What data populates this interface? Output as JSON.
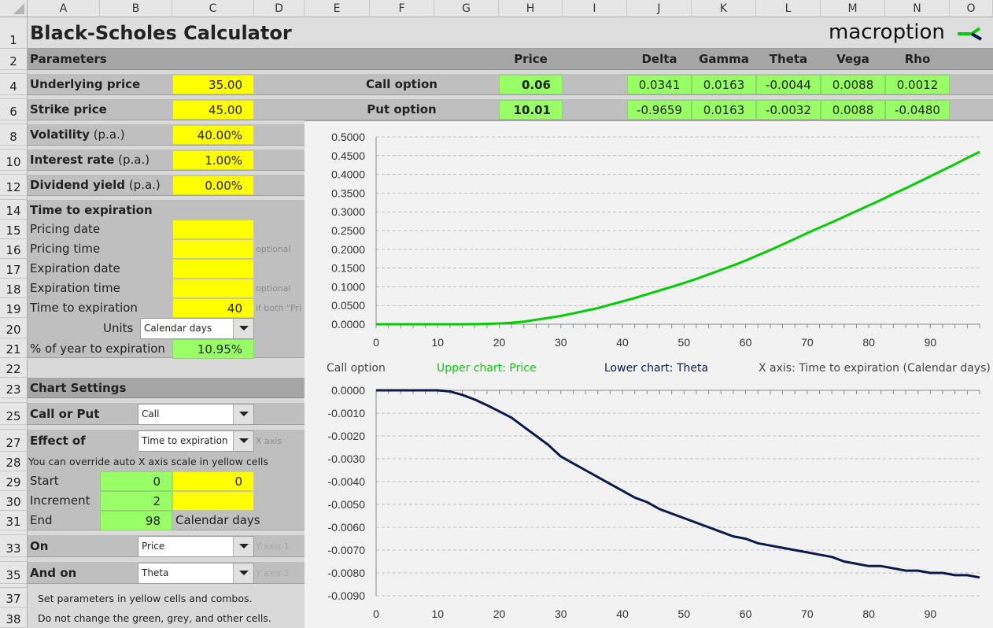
{
  "columns": [
    "A",
    "B",
    "C",
    "D",
    "E",
    "F",
    "G",
    "H",
    "I",
    "J",
    "K",
    "L",
    "M",
    "N",
    "O"
  ],
  "rows": [
    "1",
    "2",
    "4",
    "6",
    "8",
    "10",
    "12",
    "14",
    "15",
    "16",
    "17",
    "18",
    "19",
    "20",
    "21",
    "22",
    "23",
    "25",
    "27",
    "28",
    "29",
    "30",
    "31",
    "33",
    "35",
    "37",
    "38"
  ],
  "title": "Black-Scholes Calculator",
  "logo": {
    "text": "macroption",
    "colors": [
      "#00cc00",
      "#0b1a4a"
    ]
  },
  "parameters": {
    "header": "Parameters",
    "underlying_label": "Underlying price",
    "underlying": "35.00",
    "strike_label": "Strike price",
    "strike": "45.00",
    "volatility_label": "Volatility",
    "volatility_suffix": "(p.a.)",
    "volatility": "40.00%",
    "interest_label": "Interest rate",
    "interest_suffix": "(p.a.)",
    "interest": "1.00%",
    "dividend_label": "Dividend yield",
    "dividend_suffix": "(p.a.)",
    "dividend": "0.00%"
  },
  "time": {
    "header": "Time to expiration",
    "pricing_date_label": "Pricing date",
    "pricing_date": "",
    "pricing_time_label": "Pricing time",
    "pricing_time": "",
    "pricing_time_note": "optional",
    "expiration_date_label": "Expiration date",
    "expiration_date": "",
    "expiration_time_label": "Expiration time",
    "expiration_time": "",
    "expiration_time_note": "optional",
    "tte_label": "Time to expiration",
    "tte": "40",
    "tte_note": "if both \"Pri",
    "units_label": "Units",
    "units": "Calendar days",
    "pct_label": "% of year to expiration",
    "pct": "10.95%"
  },
  "chart_settings": {
    "header": "Chart Settings",
    "call_put_label": "Call or Put",
    "call_put": "Call",
    "effect_label": "Effect of",
    "effect": "Time to expiration",
    "effect_note": "X axis",
    "override_note": "You can override auto X axis scale in yellow cells",
    "start_label": "Start",
    "start_auto": "0",
    "start_override": "0",
    "increment_label": "Increment",
    "increment_auto": "2",
    "increment_override": "",
    "end_label": "End",
    "end_auto": "98",
    "end_unit": "Calendar days",
    "on_label": "On",
    "on": "Price",
    "on_note": "Y axis 1",
    "and_on_label": "And on",
    "and_on": "Theta",
    "and_on_note": "Y axis 2",
    "help1": "Set parameters in yellow cells and combos.",
    "help2": "Do not change the green, grey, and other cells."
  },
  "results": {
    "headers": [
      "Price",
      "Delta",
      "Gamma",
      "Theta",
      "Vega",
      "Rho"
    ],
    "call": {
      "label": "Call option",
      "price": "0.06",
      "greeks": [
        "0.0341",
        "0.0163",
        "-0.0044",
        "0.0088",
        "0.0012"
      ]
    },
    "put": {
      "label": "Put option",
      "price": "10.01",
      "greeks": [
        "-0.9659",
        "0.0163",
        "-0.0032",
        "0.0088",
        "-0.0480"
      ]
    }
  },
  "chart_caption": {
    "option": "Call option",
    "upper": "Upper chart: Price",
    "lower": "Lower chart: Theta",
    "xaxis": "X axis: Time to expiration (Calendar days)"
  },
  "chart_data": [
    {
      "type": "line",
      "color": "#00cc00",
      "grid": true,
      "xlim": [
        0,
        98
      ],
      "ylim": [
        0,
        0.5
      ],
      "xticks": [
        "0",
        "10",
        "20",
        "30",
        "40",
        "50",
        "60",
        "70",
        "80",
        "90"
      ],
      "yticks": [
        "0.0000",
        "0.0500",
        "0.1000",
        "0.1500",
        "0.2000",
        "0.2500",
        "0.3000",
        "0.3500",
        "0.4000",
        "0.4500",
        "0.5000"
      ],
      "x": [
        0,
        2,
        4,
        6,
        8,
        10,
        12,
        14,
        16,
        18,
        20,
        22,
        24,
        26,
        28,
        30,
        32,
        34,
        36,
        38,
        40,
        42,
        44,
        46,
        48,
        50,
        52,
        54,
        56,
        58,
        60,
        62,
        64,
        66,
        68,
        70,
        72,
        74,
        76,
        78,
        80,
        82,
        84,
        86,
        88,
        90,
        92,
        94,
        96,
        98
      ],
      "y": [
        0,
        0,
        0,
        0,
        0,
        0,
        0,
        0,
        0.0002,
        0.001,
        0.002,
        0.004,
        0.007,
        0.012,
        0.017,
        0.022,
        0.029,
        0.036,
        0.043,
        0.052,
        0.061,
        0.07,
        0.08,
        0.09,
        0.1,
        0.11,
        0.121,
        0.133,
        0.145,
        0.157,
        0.17,
        0.184,
        0.198,
        0.213,
        0.228,
        0.243,
        0.258,
        0.272,
        0.287,
        0.302,
        0.317,
        0.332,
        0.348,
        0.363,
        0.379,
        0.395,
        0.411,
        0.427,
        0.444,
        0.46
      ]
    },
    {
      "type": "line",
      "color": "#0b1a4a",
      "grid": true,
      "xlim": [
        0,
        98
      ],
      "ylim": [
        -0.009,
        0
      ],
      "xticks": [
        "0",
        "10",
        "20",
        "30",
        "40",
        "50",
        "60",
        "70",
        "80",
        "90"
      ],
      "yticks": [
        "0.0000",
        "-0.0010",
        "-0.0020",
        "-0.0030",
        "-0.0040",
        "-0.0050",
        "-0.0060",
        "-0.0070",
        "-0.0080",
        "-0.0090"
      ],
      "x": [
        0,
        2,
        4,
        6,
        8,
        10,
        12,
        14,
        16,
        18,
        20,
        22,
        24,
        26,
        28,
        30,
        32,
        34,
        36,
        38,
        40,
        42,
        44,
        46,
        48,
        50,
        52,
        54,
        56,
        58,
        60,
        62,
        64,
        66,
        68,
        70,
        72,
        74,
        76,
        78,
        80,
        82,
        84,
        86,
        88,
        90,
        92,
        94,
        96,
        98
      ],
      "y": [
        0,
        0,
        0,
        0,
        0,
        0,
        -5e-05,
        -0.0002,
        -0.0004,
        -0.00065,
        -0.00092,
        -0.0012,
        -0.0016,
        -0.002,
        -0.0024,
        -0.0029,
        -0.0032,
        -0.0035,
        -0.0038,
        -0.0041,
        -0.0044,
        -0.0047,
        -0.0049,
        -0.0052,
        -0.0054,
        -0.0056,
        -0.0058,
        -0.006,
        -0.0062,
        -0.0064,
        -0.0065,
        -0.0067,
        -0.0068,
        -0.0069,
        -0.007,
        -0.0071,
        -0.0072,
        -0.0073,
        -0.0075,
        -0.0076,
        -0.0077,
        -0.0077,
        -0.0078,
        -0.0079,
        -0.0079,
        -0.008,
        -0.008,
        -0.0081,
        -0.0081,
        -0.0082
      ]
    }
  ]
}
